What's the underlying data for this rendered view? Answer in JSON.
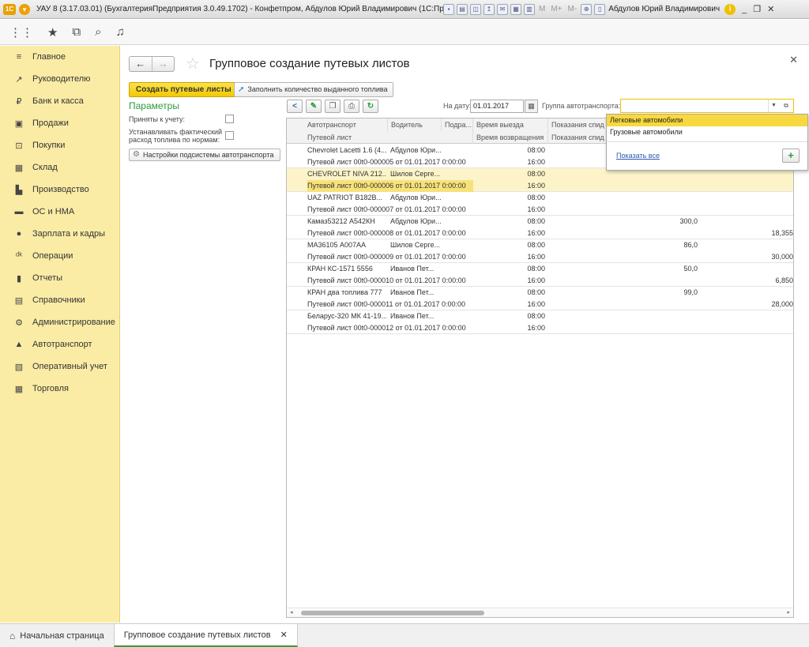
{
  "window": {
    "title": "УАУ 8 (3.17.03.01) (БухгалтерияПредприятия 3.0.49.1702) - Конфетпром, Абдулов Юрий Владимирович  (1С:Предприятие)",
    "logo_text": "1С",
    "m_labels": [
      "M",
      "M+",
      "M-"
    ],
    "user": "Абдулов Юрий Владимирович"
  },
  "sidebar": {
    "items": [
      {
        "label": "Главное",
        "icon": "≡"
      },
      {
        "label": "Руководителю",
        "icon": "↗"
      },
      {
        "label": "Банк и касса",
        "icon": "₽"
      },
      {
        "label": "Продажи",
        "icon": "▣"
      },
      {
        "label": "Покупки",
        "icon": "⊡"
      },
      {
        "label": "Склад",
        "icon": "▦"
      },
      {
        "label": "Производство",
        "icon": "▙"
      },
      {
        "label": "ОС и НМА",
        "icon": "▬"
      },
      {
        "label": "Зарплата и кадры",
        "icon": "●"
      },
      {
        "label": "Операции",
        "icon": "ᵈᵏ"
      },
      {
        "label": "Отчеты",
        "icon": "▮"
      },
      {
        "label": "Справочники",
        "icon": "▤"
      },
      {
        "label": "Администрирование",
        "icon": "⚙"
      },
      {
        "label": "Автотранспорт",
        "icon": "▲"
      },
      {
        "label": "Оперативный учет",
        "icon": "▧"
      },
      {
        "label": "Торговля",
        "icon": "▦"
      }
    ]
  },
  "page": {
    "title": "Групповое создание путевых листов",
    "create_button": "Создать путевые листы",
    "fill_button": "Заполнить количество выданного топлива",
    "params_title": "Параметры",
    "param_accepted": "Приняты к учету:",
    "param_actual_line1": "Устанавливать фактический",
    "param_actual_line2": "расход топлива по нормам:",
    "settings_button": "Настройки подсистемы автотранспорта",
    "date_label": "На дату:",
    "date_value": "01.01.2017",
    "group_label": "Группа автотранспорта:"
  },
  "grid": {
    "headers": {
      "vehicle": "Автотранспорт",
      "driver": "Водитель",
      "division": "Подра...",
      "departure": "Время выезда",
      "odometer": "Показания спид",
      "waybill": "Путевой лист",
      "return": "Время возвращения",
      "odometer2": "Показания спид"
    },
    "rows": [
      {
        "vehicle": "Chevrolet Lacetti 1.6 (4...",
        "driver": "Абдулов Юри...",
        "out": "08:00",
        "doc": "Путевой лист 00t0-000005 от 01.01.2017 0:00:00",
        "back": "16:00",
        "v1": "",
        "v2": "",
        "selected": false
      },
      {
        "vehicle": "CHEVROLET NIVA 212...",
        "driver": "Шилов Серге...",
        "out": "08:00",
        "doc": "Путевой лист 00t0-000006 от 01.01.2017 0:00:00",
        "back": "16:00",
        "v1": "",
        "v2": "",
        "selected": true
      },
      {
        "vehicle": "UAZ PATRIOT B182B...",
        "driver": "Абдулов Юри...",
        "out": "08:00",
        "doc": "Путевой лист 00t0-000007 от 01.01.2017 0:00:00",
        "back": "16:00",
        "v1": "",
        "v2": "",
        "selected": false
      },
      {
        "vehicle": "Камаз53212 А542КН",
        "driver": "Абдулов Юри...",
        "out": "08:00",
        "doc": "Путевой лист 00t0-000008 от 01.01.2017 0:00:00",
        "back": "16:00",
        "v1": "300,0",
        "v2": "18,355",
        "selected": false
      },
      {
        "vehicle": "МА36105 А007АА",
        "driver": "Шилов Серге...",
        "out": "08:00",
        "doc": "Путевой лист 00t0-000009 от 01.01.2017 0:00:00",
        "back": "16:00",
        "v1": "86,0",
        "v2": "30,000",
        "selected": false
      },
      {
        "vehicle": "КРАН КС-1571 5556",
        "driver": "Иванов  Пет...",
        "out": "08:00",
        "doc": "Путевой лист 00t0-000010 от 01.01.2017 0:00:00",
        "back": "16:00",
        "v1": "50,0",
        "v2": "6,850",
        "selected": false
      },
      {
        "vehicle": "КРАН два топлива 777",
        "driver": "Иванов  Пет...",
        "out": "08:00",
        "doc": "Путевой лист 00t0-000011 от 01.01.2017 0:00:00",
        "back": "16:00",
        "v1": "99,0",
        "v2": "28,000",
        "selected": false
      },
      {
        "vehicle": "Беларус-320 МК 41-19...",
        "driver": "Иванов  Пет...",
        "out": "08:00",
        "doc": "Путевой лист 00t0-000012 от 01.01.2017 0:00:00",
        "back": "16:00",
        "v1": "",
        "v2": "",
        "selected": false
      }
    ]
  },
  "dropdown": {
    "options": [
      "Легковые автомобили",
      "Грузовые автомобили"
    ],
    "show_all": "Показать все"
  },
  "taskbar": {
    "home": "Начальная страница",
    "active_tab": "Групповое создание путевых листов"
  }
}
